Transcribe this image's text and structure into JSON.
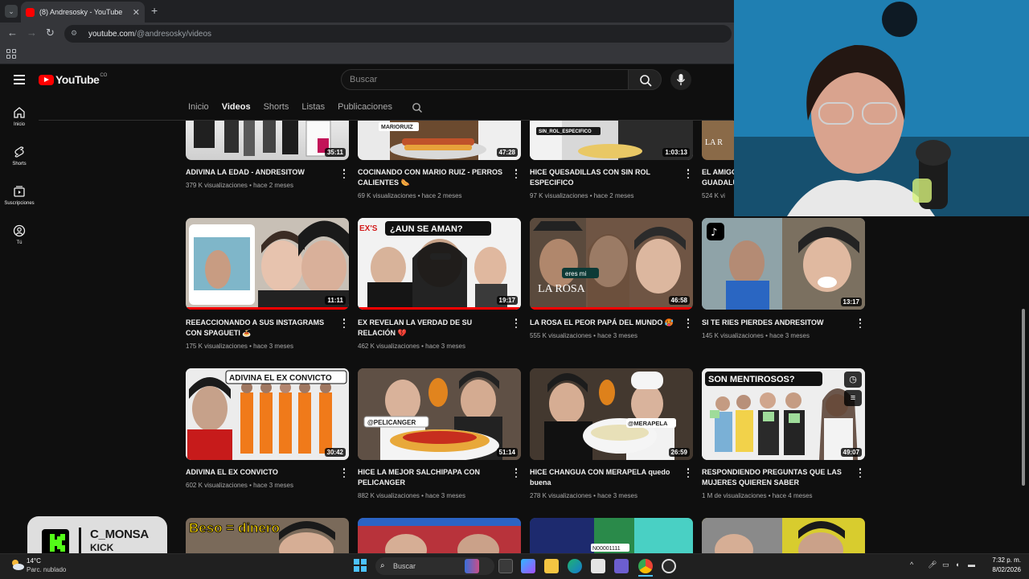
{
  "browser": {
    "tab_title": "(8) Andresosky - YouTube",
    "tab_close": "✕",
    "new_tab": "+",
    "url_host": "youtube.com",
    "url_path": "/@andresosky/videos"
  },
  "yt": {
    "logo": "YouTube",
    "country": "CO",
    "search_placeholder": "Buscar",
    "sidebar": [
      {
        "label": "Inicio",
        "icon": "home-icon"
      },
      {
        "label": "Shorts",
        "icon": "shorts-icon"
      },
      {
        "label": "Suscripciones",
        "icon": "subscriptions-icon"
      },
      {
        "label": "Tú",
        "icon": "you-icon"
      }
    ],
    "tabs": [
      "Inicio",
      "Videos",
      "Shorts",
      "Listas",
      "Publicaciones"
    ],
    "active_tab": "Videos"
  },
  "videos": [
    {
      "title": "ADIVINA LA EDAD - ANDRESITOW",
      "meta": "379 K visualizaciones • hace 2 meses",
      "duration": "35:11",
      "progress": 0
    },
    {
      "title": "COCINANDO CON MARIO RUIZ - PERROS CALIENTES 🌭",
      "meta": "69 K visualizaciones • hace 2 meses",
      "duration": "47:28",
      "progress": 0
    },
    {
      "title": "HICE QUESADILLAS CON SIN ROL ESPECIFICO",
      "meta": "97 K visualizaciones • hace 2 meses",
      "duration": "1:03:13",
      "progress": 0
    },
    {
      "title": "EL AMIGO",
      "title2": "GUADALU",
      "meta": "524 K vi",
      "duration": "",
      "progress": 0
    },
    {
      "title": "REEACCIONANDO A SUS INSTAGRAMS CON SPAGUETI 🍝",
      "meta": "175 K visualizaciones • hace 3 meses",
      "duration": "11:11",
      "progress": 1
    },
    {
      "title": "EX REVELAN LA VERDAD DE SU RELACIÓN 💔",
      "meta": "462 K visualizaciones • hace 3 meses",
      "duration": "19:17",
      "progress": 1
    },
    {
      "title": "LA ROSA EL PEOR PAPÁ DEL MUNDO 🥵",
      "meta": "555 K visualizaciones • hace 3 meses",
      "duration": "46:58",
      "progress": 1
    },
    {
      "title": "SI TE RIES PIERDES ANDRESITOW",
      "meta": "145 K visualizaciones • hace 3 meses",
      "duration": "13:17",
      "progress": 0
    },
    {
      "title": "ADIVINA EL EX CONVICTO",
      "meta": "602 K visualizaciones • hace 3 meses",
      "duration": "30:42",
      "progress": 0
    },
    {
      "title": "HICE LA MEJOR SALCHIPAPA CON PELICANGER",
      "meta": "882 K visualizaciones • hace 3 meses",
      "duration": "51:14",
      "progress": 0
    },
    {
      "title": "HICE CHANGUA CON MERAPELA quedo buena",
      "meta": "278 K visualizaciones • hace 3 meses",
      "duration": "26:59",
      "progress": 0
    },
    {
      "title": "RESPONDIENDO PREGUNTAS QUE LAS MUJERES QUIEREN SABER",
      "meta": "1 M de visualizaciones • hace 4 meses",
      "duration": "49:07",
      "progress": 0
    }
  ],
  "thumb_text": {
    "t2": "MARIORUIZ",
    "t3": "SIN_ROL_ESPECIFICO",
    "t4": "LA R",
    "t6": "¿AUN SE AMAN?",
    "t6b": "EX'S",
    "t7": "LA ROSA",
    "t7b": "eres mi",
    "t9": "ADIVINA EL EX CONVICTO",
    "t10": "@PELICANGER",
    "t11": "@MERAPELA",
    "t12": "SON MENTIROSOS?",
    "t13": "Beso = dinero",
    "t15": "N00001111"
  },
  "overlay": {
    "name": "C_MONSA",
    "platform": "KICK"
  },
  "taskbar": {
    "weather_temp": "14°C",
    "weather_desc": "Parc. nublado",
    "search": "Buscar",
    "time": "7:32 p. m.",
    "date": "8/02/2026"
  },
  "colors": {
    "accent": "#ff0000",
    "bg": "#0f0f0f"
  }
}
